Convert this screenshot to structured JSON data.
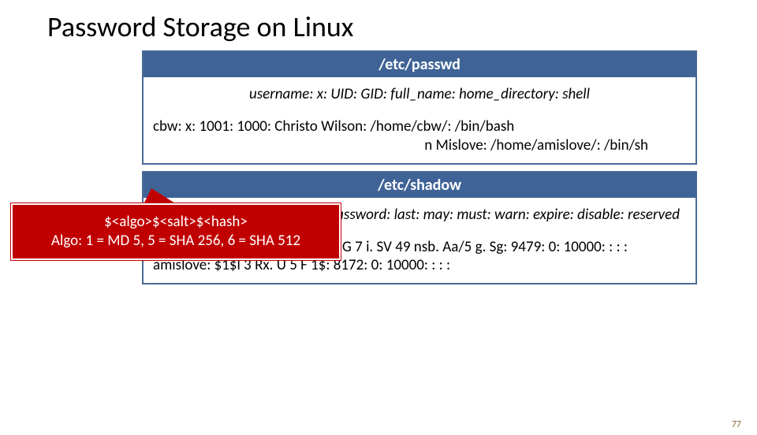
{
  "title": "Password Storage on Linux",
  "passwd": {
    "header": "/etc/passwd",
    "format": "username: x: UID: GID: full_name: home_directory: shell",
    "row1": "cbw: x: 1001: 1000: Christo Wilson: /home/cbw/: /bin/bash",
    "row2_right": "n Mislove: /home/amislove/: /bin/sh"
  },
  "callout": {
    "line1": "$<algo>$<salt>$<hash>",
    "line2": "Algo: 1 = MD 5, 5 = SHA 256, 6 = SHA 512"
  },
  "shadow": {
    "header": "/etc/shadow",
    "format_right": "ername: password: last: may: must: warn: expire: disable: reserved",
    "row1": "cbw: $1$0 n. Sd 5 ew. F$0 df/3 G 7 i. SV 49 nsb. Aa/5 g. Sg: 9479: 0: 10000: : : :",
    "row2": "amislove: $1$l 3 Rx. U 5 F 1$: 8172: 0: 10000: : : :"
  },
  "page_number": "77"
}
